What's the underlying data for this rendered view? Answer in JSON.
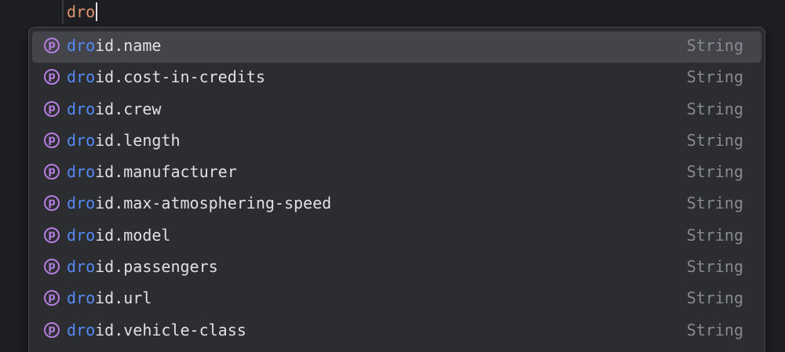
{
  "editor": {
    "typed_text": "dro"
  },
  "completion": {
    "items": [
      {
        "match": "dro",
        "rest": "id.name",
        "type": "String",
        "icon": "property-icon",
        "icon_glyph": "p",
        "selected": true
      },
      {
        "match": "dro",
        "rest": "id.cost-in-credits",
        "type": "String",
        "icon": "property-icon",
        "icon_glyph": "p",
        "selected": false
      },
      {
        "match": "dro",
        "rest": "id.crew",
        "type": "String",
        "icon": "property-icon",
        "icon_glyph": "p",
        "selected": false
      },
      {
        "match": "dro",
        "rest": "id.length",
        "type": "String",
        "icon": "property-icon",
        "icon_glyph": "p",
        "selected": false
      },
      {
        "match": "dro",
        "rest": "id.manufacturer",
        "type": "String",
        "icon": "property-icon",
        "icon_glyph": "p",
        "selected": false
      },
      {
        "match": "dro",
        "rest": "id.max-atmosphering-speed",
        "type": "String",
        "icon": "property-icon",
        "icon_glyph": "p",
        "selected": false
      },
      {
        "match": "dro",
        "rest": "id.model",
        "type": "String",
        "icon": "property-icon",
        "icon_glyph": "p",
        "selected": false
      },
      {
        "match": "dro",
        "rest": "id.passengers",
        "type": "String",
        "icon": "property-icon",
        "icon_glyph": "p",
        "selected": false
      },
      {
        "match": "dro",
        "rest": "id.url",
        "type": "String",
        "icon": "property-icon",
        "icon_glyph": "p",
        "selected": false
      },
      {
        "match": "dro",
        "rest": "id.vehicle-class",
        "type": "String",
        "icon": "property-icon",
        "icon_glyph": "p",
        "selected": false
      }
    ]
  },
  "colors": {
    "background": "#1e1f22",
    "popup_background": "#2b2d30",
    "selected_row": "#43454a",
    "match_highlight": "#548af7",
    "typed_text": "#e0956b",
    "property_icon": "#b57ee0",
    "type_text": "#868a91"
  }
}
